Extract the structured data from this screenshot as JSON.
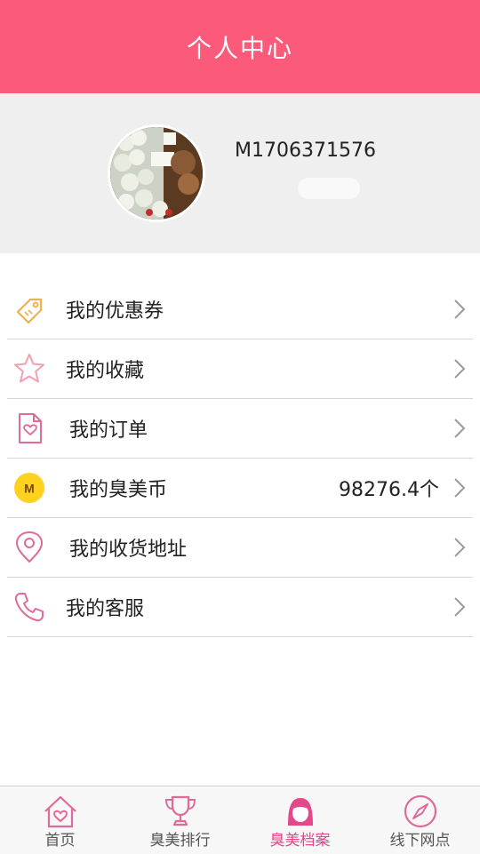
{
  "header": {
    "title": "个人中心"
  },
  "profile": {
    "user_id": "M1706371576"
  },
  "menu": [
    {
      "label": "我的优惠券",
      "value": "",
      "icon": "coupon-tag-icon"
    },
    {
      "label": "我的收藏",
      "value": "",
      "icon": "star-icon"
    },
    {
      "label": "我的订单",
      "value": "",
      "icon": "order-document-icon"
    },
    {
      "label": "我的臭美币",
      "value": "98276.4个",
      "icon": "coin-m-icon"
    },
    {
      "label": "我的收货地址",
      "value": "",
      "icon": "location-pin-icon"
    },
    {
      "label": "我的客服",
      "value": "",
      "icon": "phone-icon"
    }
  ],
  "coin_icon_letter": "M",
  "tabs": [
    {
      "label": "首页",
      "icon": "home-heart-icon",
      "active": false
    },
    {
      "label": "臭美排行",
      "icon": "trophy-icon",
      "active": false
    },
    {
      "label": "臭美档案",
      "icon": "profile-girl-icon",
      "active": true
    },
    {
      "label": "线下网点",
      "icon": "compass-icon",
      "active": false
    }
  ],
  "colors": {
    "header": "#fc5a7a",
    "accent": "#e4478a",
    "coupon": "#f0b050",
    "coin": "#ffd21f"
  }
}
